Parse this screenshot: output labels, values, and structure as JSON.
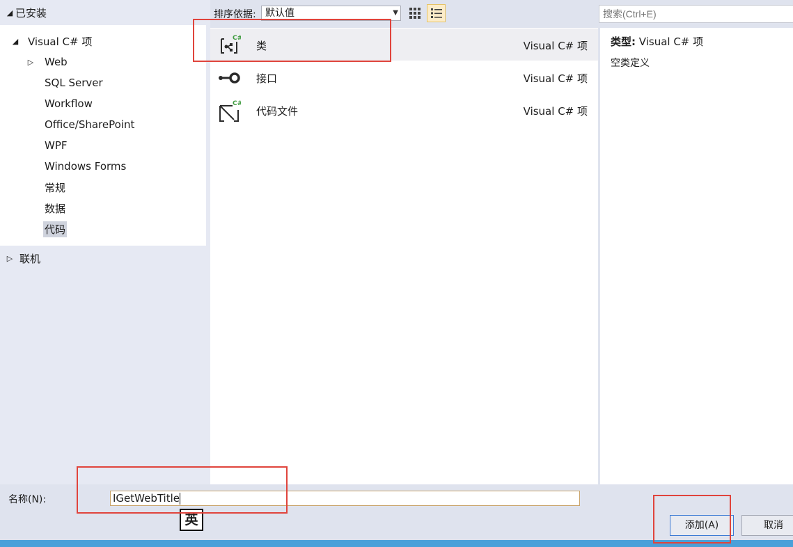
{
  "tree": {
    "installed_label": "已安装",
    "visual_csharp_label": "Visual C# 项",
    "items": [
      "Web",
      "SQL Server",
      "Workflow",
      "Office/SharePoint",
      "WPF",
      "Windows Forms",
      "常规",
      "数据",
      "代码"
    ],
    "selected_item": "代码",
    "online_label": "联机"
  },
  "toolbar": {
    "sort_label": "排序依据:",
    "sort_value": "默认值",
    "view_grid_icon": "grid-view-icon",
    "view_list_icon": "list-view-icon",
    "selected_view": "list"
  },
  "search": {
    "placeholder": "搜索(Ctrl+E)"
  },
  "templates": [
    {
      "name": "类",
      "type": "Visual C# 项",
      "icon": "class-icon",
      "selected": true
    },
    {
      "name": "接口",
      "type": "Visual C# 项",
      "icon": "interface-icon",
      "selected": false
    },
    {
      "name": "代码文件",
      "type": "Visual C# 项",
      "icon": "code-file-icon",
      "selected": false
    }
  ],
  "info": {
    "type_label": "类型:",
    "type_value": "Visual C# 项",
    "description": "空类定义"
  },
  "bottom": {
    "name_label": "名称(N):",
    "name_value": "IGetWebTitle",
    "ime_indicator": "英",
    "add_label": "添加(A)",
    "cancel_label": "取消"
  },
  "colors": {
    "annotation_red": "#e0443c",
    "accent_blue": "#4aa0d9",
    "selected_row": "#eeeef2",
    "csharp_green": "#3e9b3e"
  }
}
